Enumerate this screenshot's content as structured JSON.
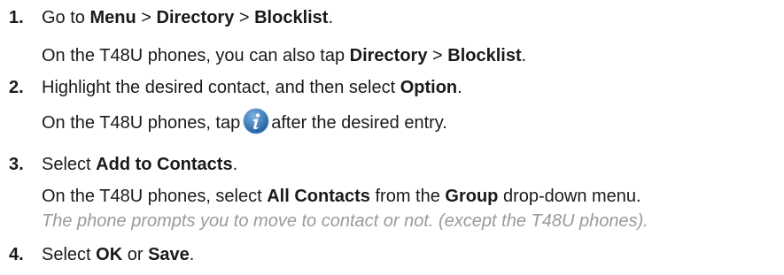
{
  "steps": [
    {
      "number": "1.",
      "parts": [
        "Go to ",
        "Menu",
        " > ",
        "Directory",
        " > ",
        "Blocklist",
        "."
      ],
      "sub": [
        "On the T48U phones, you can also tap ",
        "Directory",
        " > ",
        "Blocklist",
        "."
      ]
    },
    {
      "number": "2.",
      "parts": [
        "Highlight the desired contact, and then select ",
        "Option",
        "."
      ],
      "sub": [
        "On the T48U phones, tap",
        "after the desired entry."
      ],
      "icon": "info-icon"
    },
    {
      "number": "3.",
      "parts": [
        "Select ",
        "Add to Contacts",
        "."
      ],
      "sub": [
        "On the T48U phones, select ",
        "All Contacts",
        " from the ",
        "Group",
        " drop-down menu."
      ],
      "note": "The phone prompts you to move to contact or not. (except the T48U phones)."
    },
    {
      "number": "4.",
      "parts": [
        "Select ",
        "OK",
        " or ",
        "Save",
        "."
      ]
    }
  ],
  "colors": {
    "text": "#1a1a1a",
    "note": "#9a9a9a",
    "icon_blue": "#2f76b8"
  }
}
